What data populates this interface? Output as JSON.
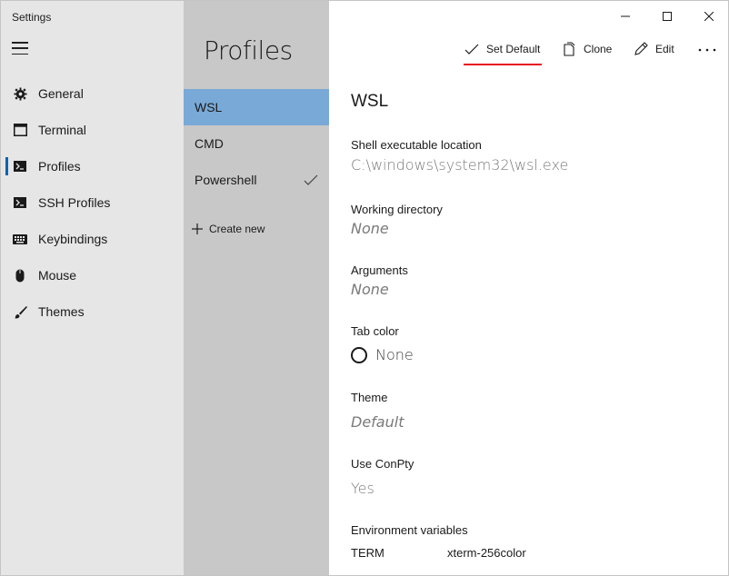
{
  "window": {
    "title": "Settings"
  },
  "nav": {
    "items": [
      {
        "label": "General",
        "icon": "gear-icon"
      },
      {
        "label": "Terminal",
        "icon": "window-icon"
      },
      {
        "label": "Profiles",
        "icon": "console-prompt-icon",
        "selected": true
      },
      {
        "label": "SSH Profiles",
        "icon": "console-prompt-icon"
      },
      {
        "label": "Keybindings",
        "icon": "keyboard-icon"
      },
      {
        "label": "Mouse",
        "icon": "mouse-icon"
      },
      {
        "label": "Themes",
        "icon": "brush-icon"
      }
    ]
  },
  "profiles": {
    "title": "Profiles",
    "items": [
      {
        "label": "WSL",
        "selected": true
      },
      {
        "label": "CMD"
      },
      {
        "label": "Powershell",
        "default": true
      }
    ],
    "create_new": "Create new"
  },
  "commands": {
    "set_default": "Set Default",
    "clone": "Clone",
    "edit": "Edit"
  },
  "detail": {
    "title": "WSL",
    "shell_label": "Shell executable location",
    "shell_value": "C:\\windows\\system32\\wsl.exe",
    "workdir_label": "Working directory",
    "workdir_value": "None",
    "args_label": "Arguments",
    "args_value": "None",
    "tabcolor_label": "Tab color",
    "tabcolor_value": "None",
    "theme_label": "Theme",
    "theme_value": "Default",
    "conpty_label": "Use ConPty",
    "conpty_value": "Yes",
    "env_label": "Environment variables",
    "env": [
      {
        "key": "TERM",
        "value": "xterm-256color"
      }
    ]
  },
  "colors": {
    "selection": "#79a9d6",
    "accent_underline": "#e81123",
    "nav_bg": "#e6e6e6",
    "list_bg": "#c8c8c8"
  }
}
